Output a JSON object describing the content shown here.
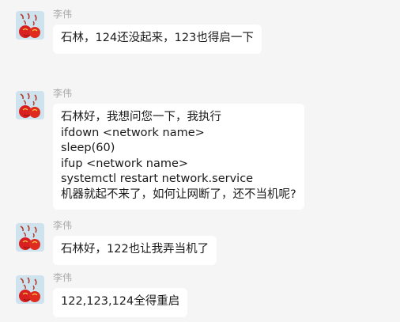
{
  "chat": {
    "messages": [
      {
        "sender": "李伟",
        "lines": [
          "石林，124还没起来，123也得启一下"
        ]
      },
      {
        "sender": "李伟",
        "lines": [
          "石林好，我想问您一下，我执行",
          "ifdown <network name>",
          "sleep(60)",
          "ifup <network name>",
          "systemctl restart network.service",
          "机器就起不来了，如何让网断了，还不当机呢?"
        ]
      },
      {
        "sender": "李伟",
        "lines": [
          "石林好，122也让我弄当机了"
        ]
      },
      {
        "sender": "李伟",
        "lines": [
          "122,123,124全得重启"
        ]
      }
    ]
  },
  "colors": {
    "background": "#f5f5f5",
    "bubble": "#ffffff",
    "sender_name": "#a9a9a9",
    "message_text": "#1a1a1a"
  },
  "icons": {
    "avatar": "avatar-icon"
  }
}
